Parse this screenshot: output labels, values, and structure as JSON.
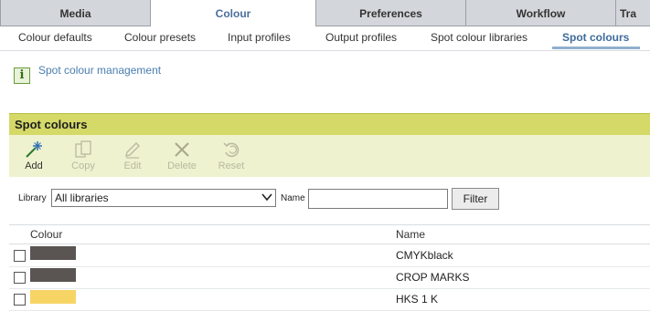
{
  "main_tabs": [
    {
      "label": "Media",
      "active": false
    },
    {
      "label": "Colour",
      "active": true
    },
    {
      "label": "Preferences",
      "active": false
    },
    {
      "label": "Workflow",
      "active": false
    },
    {
      "label": "Tra",
      "active": false
    }
  ],
  "sub_tabs": [
    {
      "label": "Colour defaults",
      "active": false
    },
    {
      "label": "Colour presets",
      "active": false
    },
    {
      "label": "Input profiles",
      "active": false
    },
    {
      "label": "Output profiles",
      "active": false
    },
    {
      "label": "Spot colour libraries",
      "active": false
    },
    {
      "label": "Spot colours",
      "active": true
    }
  ],
  "info": {
    "icon": "info-icon",
    "glyph": "i",
    "link_text": "Spot colour management"
  },
  "panel": {
    "title": "Spot colours"
  },
  "toolbar": [
    {
      "label": "Add",
      "icon": "add-sparkle-icon",
      "enabled": true
    },
    {
      "label": "Copy",
      "icon": "copy-icon",
      "enabled": false
    },
    {
      "label": "Edit",
      "icon": "pencil-icon",
      "enabled": false
    },
    {
      "label": "Delete",
      "icon": "delete-x-icon",
      "enabled": false
    },
    {
      "label": "Reset",
      "icon": "reset-icon",
      "enabled": false
    }
  ],
  "filter": {
    "library_label": "Library",
    "library_value": "All libraries",
    "name_label": "Name",
    "name_value": "",
    "filter_button": "Filter"
  },
  "table": {
    "columns": [
      "Colour",
      "Name"
    ],
    "rows": [
      {
        "name": "CMYKblack",
        "swatch": "#5a5552",
        "checked": false
      },
      {
        "name": "CROP MARKS",
        "swatch": "#5a5552",
        "checked": false
      },
      {
        "name": "HKS 1 K",
        "swatch": "#f6d565",
        "checked": false
      }
    ]
  },
  "colors": {
    "accent": "#4a7db0",
    "panel_header": "#d4d968",
    "toolbar_bg": "#eef2cf"
  }
}
